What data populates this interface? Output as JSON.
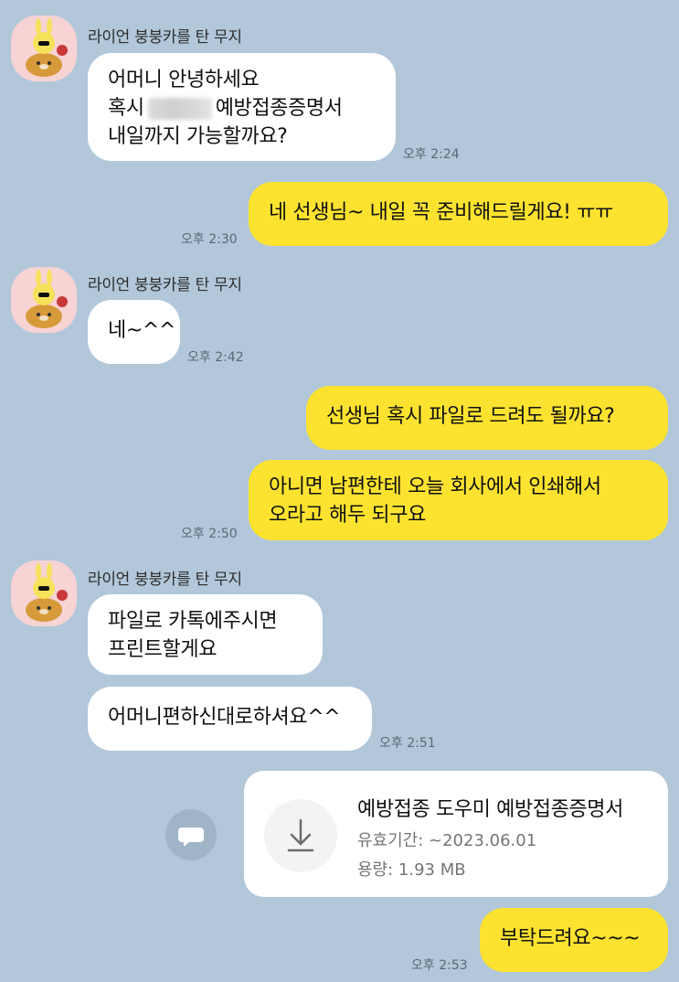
{
  "colors": {
    "background": "#b2c7da",
    "incoming_bubble": "#ffffff",
    "outgoing_bubble": "#fde32f",
    "avatar_bg": "#f7d3d3"
  },
  "contact": {
    "name": "라이언 붕붕카를 탄 무지",
    "avatar_icon": "muzi-riding-ryan-icon"
  },
  "messages": {
    "m1": {
      "line1": "어머니 안녕하세요",
      "line2_a": "혹시",
      "line2_b": "예방접종증명서",
      "line3": "내일까지 가능할까요?",
      "time": "오후 2:24"
    },
    "m2": {
      "text": "네 선생님~ 내일 꼭 준비해드릴게요! ㅠㅠ",
      "time": "오후 2:30"
    },
    "m3": {
      "text": "네~^^",
      "time": "오후 2:42"
    },
    "m4": {
      "text": "선생님 혹시 파일로 드려도 될까요?"
    },
    "m5": {
      "line1": "아니면 남편한테 오늘 회사에서 인쇄해서",
      "line2": "오라고 해두 되구요",
      "time": "오후 2:50"
    },
    "m6": {
      "line1": "파일로 카톡에주시면",
      "line2": "프린트할게요"
    },
    "m7": {
      "text": "어머니편하신대로하셔요^^",
      "time": "오후 2:51"
    },
    "m8": {
      "text": "부탁드려요~~~",
      "time": "오후 2:53"
    }
  },
  "file": {
    "title": "예방접종 도우미 예방접종증명서",
    "validity": "유효기간: ~2023.06.01",
    "size": "용량: 1.93 MB",
    "download_icon": "download-icon",
    "share_icon": "speech-bubble-icon"
  }
}
